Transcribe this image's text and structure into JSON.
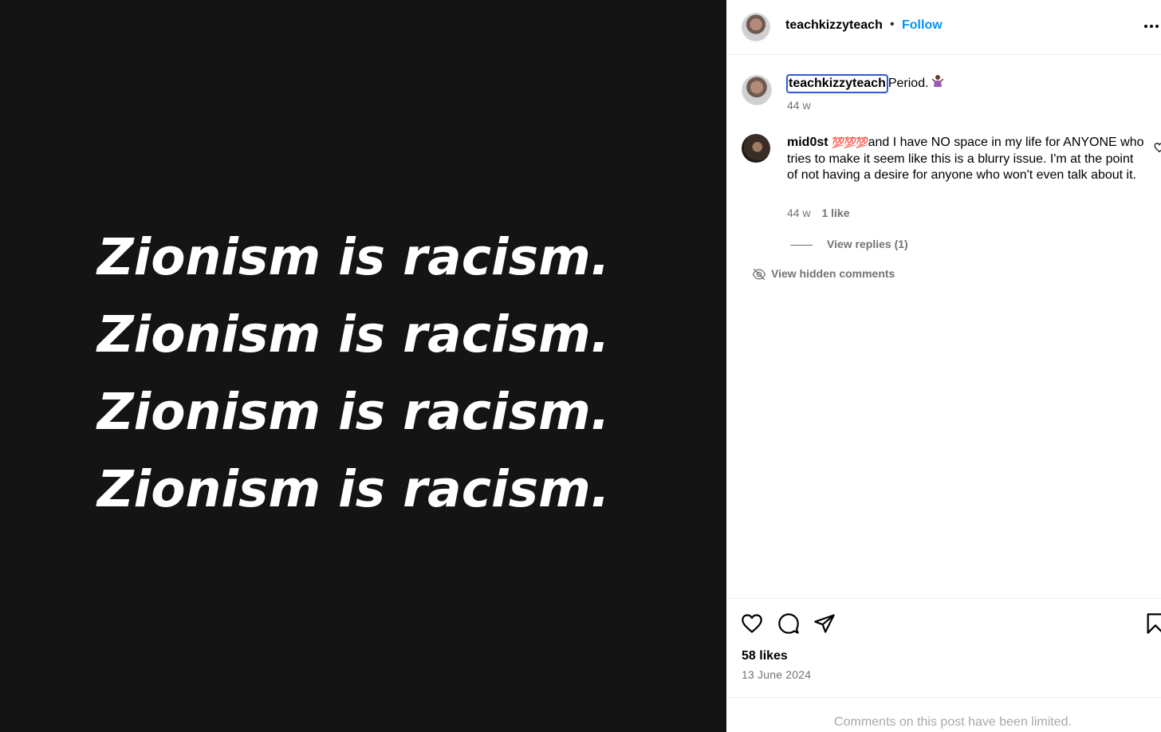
{
  "media": {
    "lines": [
      "Zionism is racism.",
      "Zionism is racism.",
      "Zionism is racism.",
      "Zionism is racism."
    ]
  },
  "header": {
    "username": "teachkizzyteach",
    "separator": "•",
    "follow_label": "Follow",
    "more_icon": "more-horizontal-icon"
  },
  "caption": {
    "username": "teachkizzyteach",
    "text": "Period.",
    "emoji_icon": "woman-shrugging-emoji",
    "time": "44 w"
  },
  "comment": {
    "username": "mid0st",
    "emoji": "💯💯💯",
    "text": "and I have NO space in my life for ANYONE who tries to make it seem like this is a blurry issue. I'm at the point of not having a desire for anyone who won't even talk about it.",
    "time": "44 w",
    "likes": "1 like",
    "view_replies": "View replies (1)"
  },
  "hidden_comments_label": "View hidden comments",
  "actions": {
    "likes": "58 likes",
    "date": "13 June 2024"
  },
  "footer": {
    "text": "Comments on this post have been limited."
  },
  "colors": {
    "media_bg": "#141414",
    "follow": "#0095f6",
    "muted": "#737373",
    "focus_ring": "#2f5bd3"
  }
}
